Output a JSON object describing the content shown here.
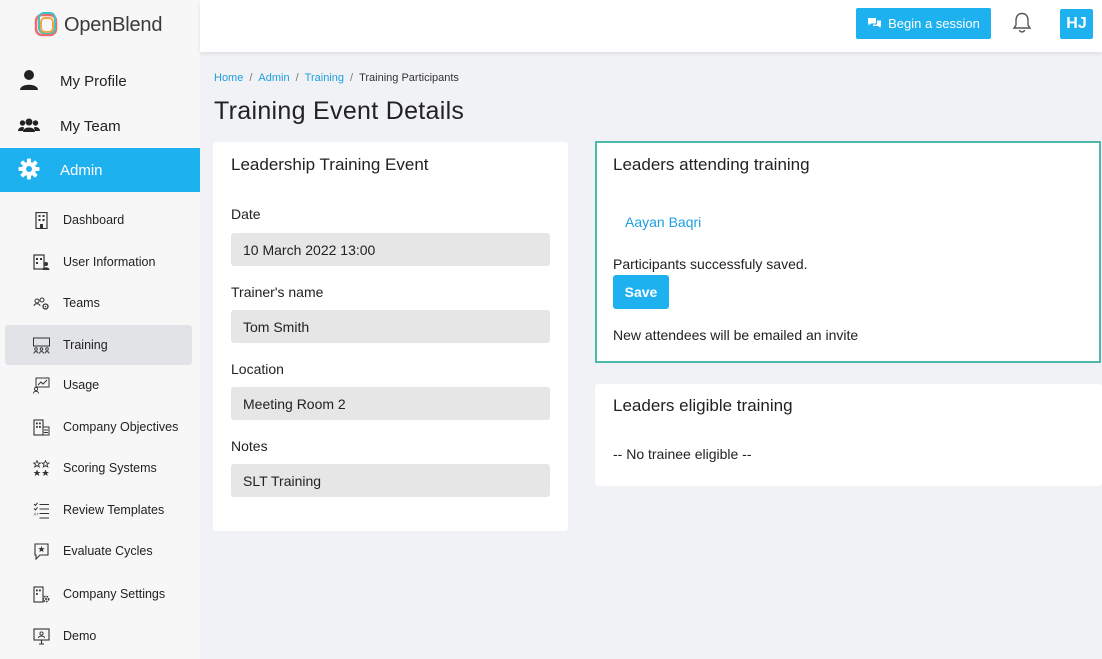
{
  "app": {
    "logo_text": "OpenBlend"
  },
  "sidebar": {
    "main_items": [
      {
        "label": "My Profile",
        "icon": "user-icon"
      },
      {
        "label": "My Team",
        "icon": "team-icon"
      },
      {
        "label": "Admin",
        "icon": "gear-icon",
        "active": true
      }
    ],
    "sub_items": [
      {
        "label": "Dashboard",
        "icon": "building-icon"
      },
      {
        "label": "User Information",
        "icon": "user-info-icon"
      },
      {
        "label": "Teams",
        "icon": "teams-icon"
      },
      {
        "label": "Training",
        "icon": "training-icon",
        "active": true
      },
      {
        "label": "Usage",
        "icon": "usage-icon"
      },
      {
        "label": "Company Objectives",
        "icon": "objectives-icon"
      },
      {
        "label": "Scoring Systems",
        "icon": "stars-icon"
      },
      {
        "label": "Review Templates",
        "icon": "list-icon"
      },
      {
        "label": "Evaluate Cycles",
        "icon": "evaluate-icon"
      },
      {
        "label": "Company Settings",
        "icon": "company-settings-icon"
      },
      {
        "label": "Demo",
        "icon": "monitor-icon"
      }
    ]
  },
  "header": {
    "session_button": "Begin a session",
    "avatar_initials": "HJ"
  },
  "breadcrumb": {
    "home": "Home",
    "admin": "Admin",
    "training": "Training",
    "current": "Training Participants"
  },
  "page_title": "Training Event Details",
  "event": {
    "title": "Leadership Training Event",
    "date_label": "Date",
    "date_value": "10 March 2022 13:00",
    "trainer_label": "Trainer's name",
    "trainer_value": "Tom Smith",
    "location_label": "Location",
    "location_value": "Meeting Room 2",
    "notes_label": "Notes",
    "notes_value": "SLT Training"
  },
  "attending": {
    "title": "Leaders attending training",
    "leaders": [
      "Aayan Baqri"
    ],
    "saved_message": "Participants successfuly saved.",
    "save_button": "Save",
    "invite_note": "New attendees will be emailed an invite"
  },
  "eligible": {
    "title": "Leaders eligible training",
    "empty_message": "-- No trainee eligible --"
  },
  "colors": {
    "accent": "#1eb1f0",
    "link": "#1e9fe0",
    "highlight_border": "#4bb8a9"
  }
}
